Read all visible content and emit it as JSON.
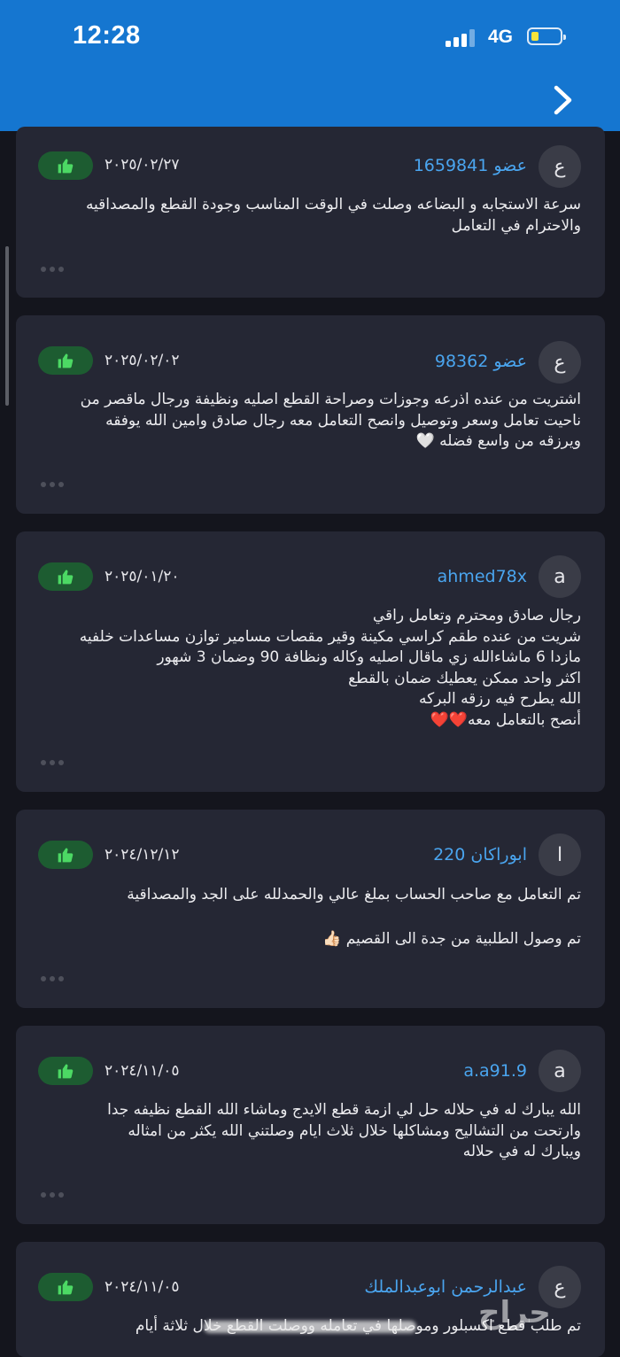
{
  "status_bar": {
    "time": "12:28",
    "network": "4G"
  },
  "reviews": [
    {
      "avatar": "ع",
      "username": "عضو 1659841",
      "date": "٢٠٢٥/٠٢/٢٧",
      "text": "سرعة الاستجابه و البضاعه وصلت في الوقت المناسب وجودة القطع والمصداقيه\nوالاحترام في التعامل"
    },
    {
      "avatar": "ع",
      "username": "عضو 98362",
      "date": "٢٠٢٥/٠٢/٠٢",
      "text": "اشتريت من عنده اذرعه وجوزات وصراحة القطع اصليه ونظيفة ورجال ماقصر من\nناحيت تعامل وسعر وتوصيل وانصح التعامل معه رجال صادق وامين الله يوفقه\nويرزقه من واسع فضله 🤍"
    },
    {
      "avatar": "a",
      "username": "ahmed78x",
      "date": "٢٠٢٥/٠١/٢٠",
      "text": "رجال صادق ومحترم وتعامل راقي\nشريت من عنده طقم كراسي مكينة وقير مقصات مسامير توازن مساعدات خلفيه\nمازدا 6 ماشاءالله زي ماقال اصليه وكاله ونظافة 90  وضمان 3 شهور\nاكثر واحد ممكن يعطيك ضمان بالقطع\nالله يطرح فيه رزقه البركه\nأنصح بالتعامل معه❤️❤️"
    },
    {
      "avatar": "ا",
      "username": "ابوراكان 220",
      "date": "٢٠٢٤/١٢/١٢",
      "text": "تم التعامل مع صاحب الحساب بملغ عالي والحمدلله على الجد والمصداقية\n\nتم وصول الطلبية من جدة الى القصيم 👍🏻"
    },
    {
      "avatar": "a",
      "username": "a.a91.9",
      "date": "٢٠٢٤/١١/٠٥",
      "text": "الله يبارك له في حلاله حل لي ازمة قطع الايدج وماشاء الله القطع نظيفه جدا\nوارتحت من التشاليح ومشاكلها   خلال ثلاث ايام وصلتني   الله يكثر من امثاله\nويبارك له في حلاله"
    },
    {
      "avatar": "ع",
      "username": "عبدالرحمن ابوعبدالملك",
      "date": "٢٠٢٤/١١/٠٥",
      "text": "تم طلب قطع اكسبلور وموصلها في تعامله ووصلت القطع خلال ثلاثة أيام"
    }
  ],
  "watermark": "حراج",
  "colors": {
    "header": "#1576d0",
    "background": "#14151d",
    "card": "#252734",
    "username": "#4aa5ef",
    "like": "#1d5c31",
    "like_icon": "#4cd964"
  }
}
